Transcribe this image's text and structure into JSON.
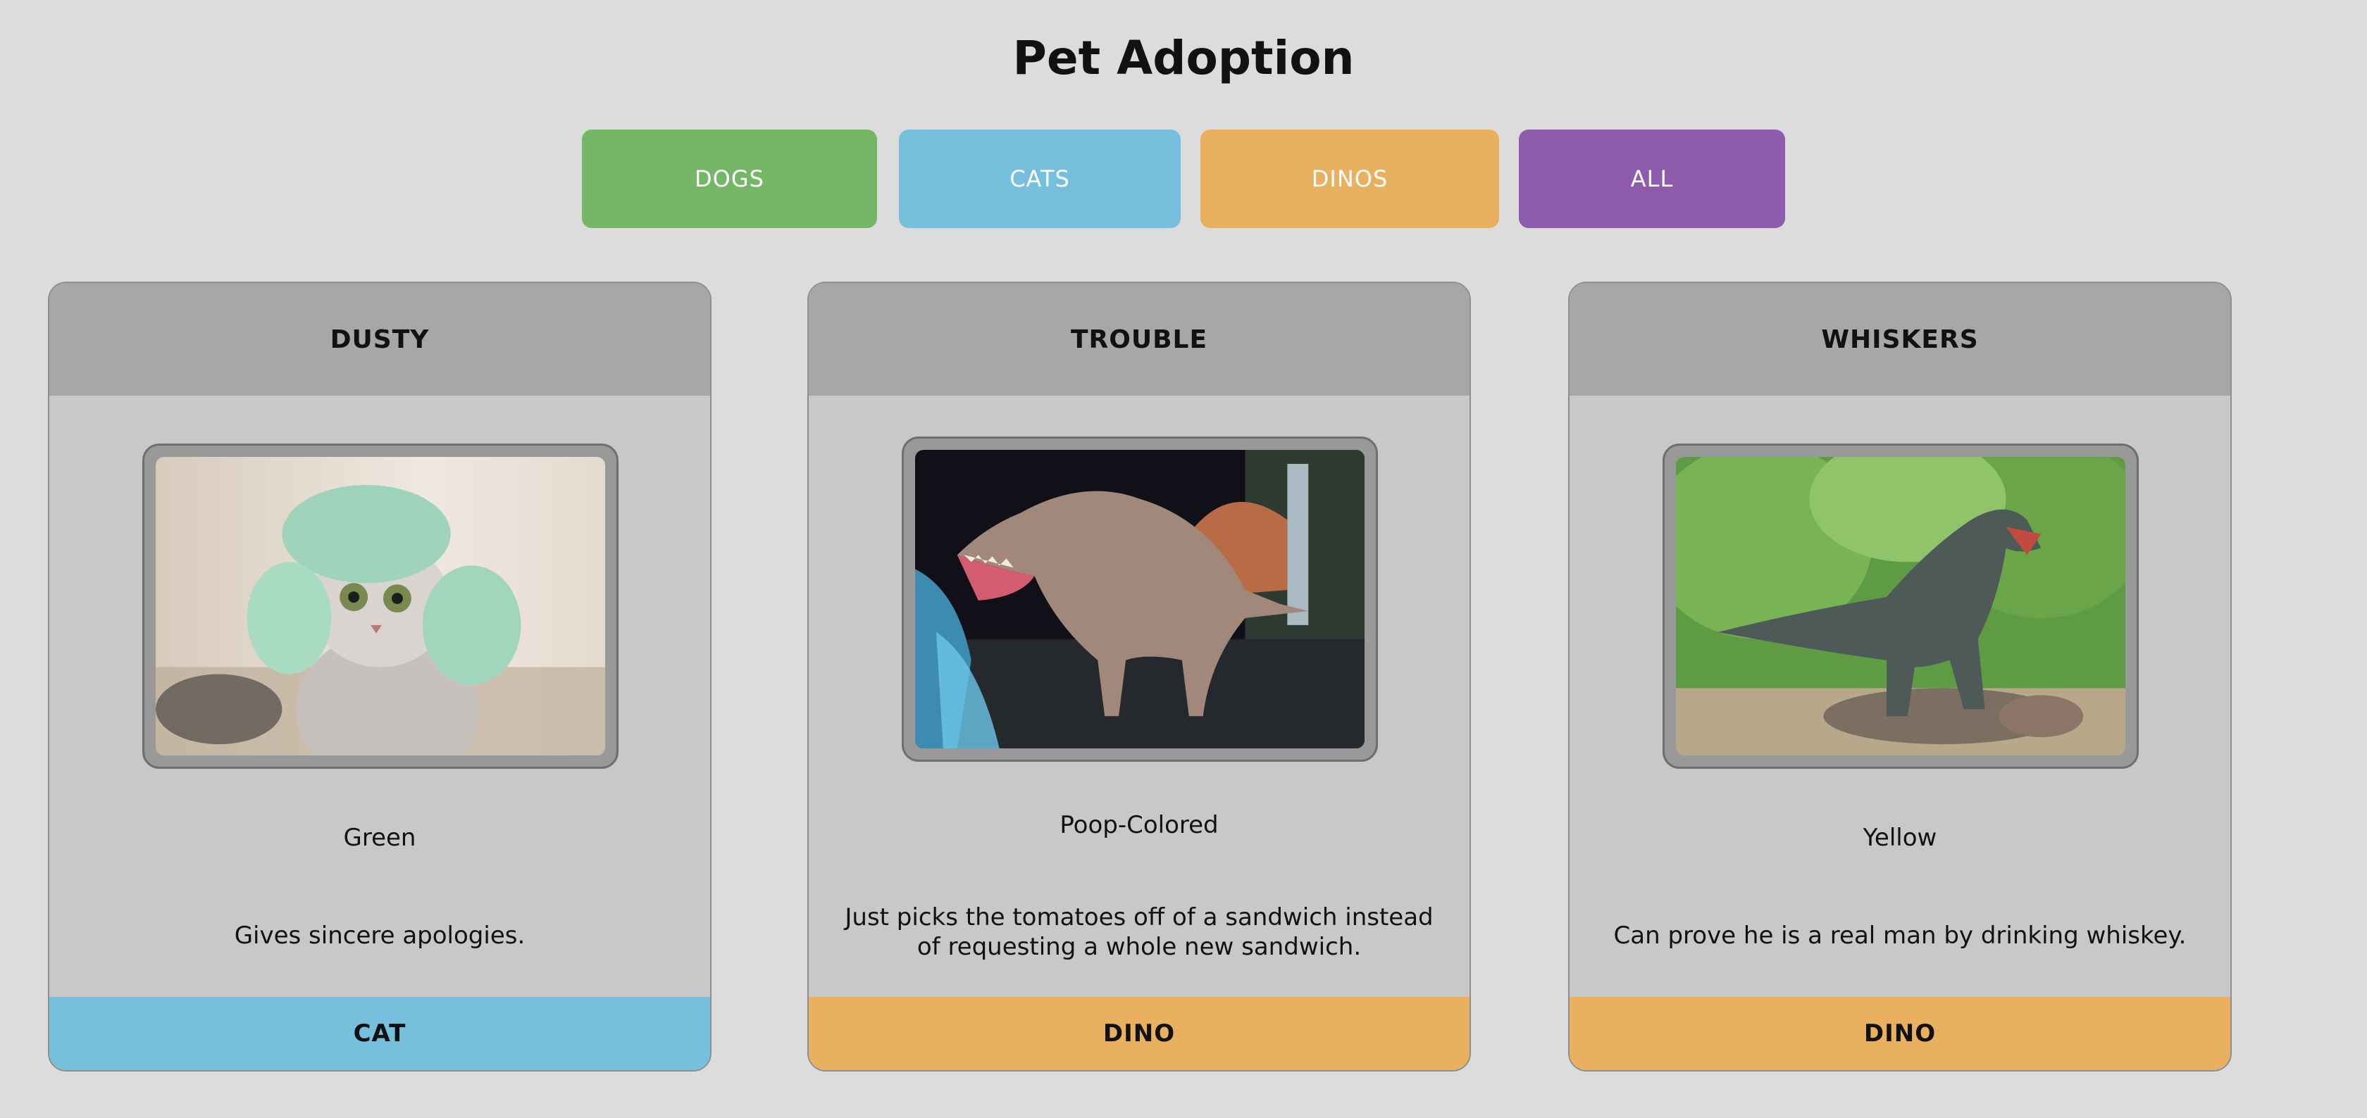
{
  "page": {
    "title": "Pet Adoption"
  },
  "filters": [
    {
      "label": "DOGS",
      "color": "#75b667"
    },
    {
      "label": "CATS",
      "color": "#76c0dd"
    },
    {
      "label": "DINOS",
      "color": "#e8b05f"
    },
    {
      "label": "ALL",
      "color": "#8e5bad"
    }
  ],
  "pets": [
    {
      "name": "DUSTY",
      "color": "Green",
      "description": "Gives sincere apologies.",
      "type": "CAT",
      "type_color": "#76c0dd",
      "photo": "cat-with-towel-bun-photo"
    },
    {
      "name": "TROUBLE",
      "color": "Poop-Colored",
      "description": "Just picks the tomatoes off of a sandwich instead of requesting a whole new sandwich.",
      "type": "DINO",
      "type_color": "#e8b05f",
      "photo": "spinosaurus-photo"
    },
    {
      "name": "WHISKERS",
      "color": "Yellow",
      "description": "Can prove he is a real man by drinking whiskey.",
      "type": "DINO",
      "type_color": "#e8b05f",
      "photo": "t-rex-in-forest-photo"
    }
  ]
}
